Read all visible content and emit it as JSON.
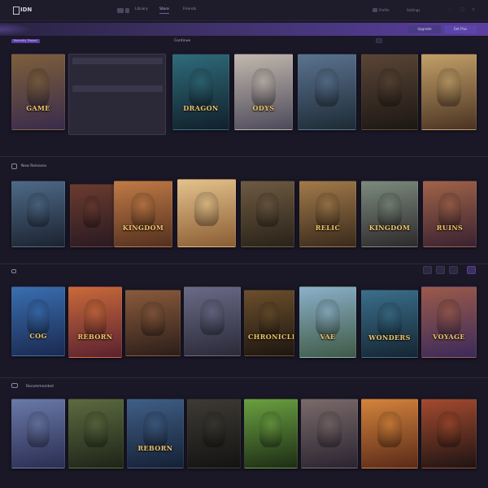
{
  "app": {
    "logo_text": "IDN"
  },
  "topbar": {
    "nav": [
      "Library",
      "Store",
      "Friends"
    ],
    "links": [
      "Profile",
      "Settings"
    ],
    "window_controls": [
      "–",
      "□",
      "×"
    ]
  },
  "banner": {
    "buttons": [
      "Upgrade",
      "Get Plus"
    ]
  },
  "sections": [
    {
      "tag": "Recently Played",
      "title": "Continue",
      "meta": ""
    },
    {
      "tag": "",
      "title": "New Releases",
      "meta": ""
    },
    {
      "tag": "",
      "title": "",
      "meta": ""
    },
    {
      "tag": "",
      "title": "Recommended",
      "meta": ""
    }
  ],
  "panel_rows": [
    "",
    "",
    "",
    "",
    "",
    "",
    ""
  ],
  "row1": [
    {
      "title": "GAME",
      "colors": [
        "#7d5f3b",
        "#3a2b4c"
      ]
    },
    {
      "title": "",
      "colors": []
    },
    {
      "title": "DRAGON",
      "colors": [
        "#2f6b7a",
        "#11202b"
      ]
    },
    {
      "title": "ODYS",
      "colors": [
        "#c2b8ad",
        "#4d4a5b"
      ]
    },
    {
      "title": "",
      "colors": [
        "#5b7390",
        "#1e2b36"
      ]
    },
    {
      "title": "",
      "colors": [
        "#5a4536",
        "#1c1713"
      ]
    },
    {
      "title": "",
      "colors": [
        "#c3a068",
        "#4a3322"
      ]
    }
  ],
  "row2": [
    {
      "title": "",
      "colors": [
        "#4e6a88",
        "#1c2330"
      ]
    },
    {
      "title": "",
      "colors": [
        "#6b3b2e",
        "#2a1a22"
      ]
    },
    {
      "title": "KINGDOM",
      "colors": [
        "#c07a46",
        "#54301f"
      ]
    },
    {
      "title": "",
      "colors": [
        "#e3c28c",
        "#8b5d33"
      ]
    },
    {
      "title": "",
      "colors": [
        "#6d5a42",
        "#2a2218"
      ]
    },
    {
      "title": "RELIC",
      "colors": [
        "#a27a4a",
        "#3a2a1c"
      ]
    },
    {
      "title": "KINGDOM",
      "colors": [
        "#7c8a7e",
        "#2d2a2c"
      ]
    },
    {
      "title": "RUINS",
      "colors": [
        "#a06348",
        "#3a2231"
      ]
    }
  ],
  "row3": [
    {
      "title": "COG",
      "colors": [
        "#3a6eb0",
        "#1a2a50"
      ]
    },
    {
      "title": "REBORN",
      "colors": [
        "#c96a3a",
        "#5b2130"
      ]
    },
    {
      "title": "",
      "colors": [
        "#8a5a3c",
        "#2c1e19"
      ]
    },
    {
      "title": "",
      "colors": [
        "#6a6a88",
        "#2a2a38"
      ]
    },
    {
      "title": "CHRONICLE",
      "colors": [
        "#6b4e2c",
        "#1d1610"
      ]
    },
    {
      "title": "VAE",
      "colors": [
        "#8bb0c9",
        "#3f5a45"
      ]
    },
    {
      "title": "WONDERS",
      "colors": [
        "#3a6f8a",
        "#152533"
      ]
    },
    {
      "title": "VOYAGE",
      "colors": [
        "#9b5a4a",
        "#3b2a5a"
      ]
    }
  ],
  "row4": [
    {
      "title": "",
      "colors": [
        "#6a79a8",
        "#2a2e52"
      ]
    },
    {
      "title": "",
      "colors": [
        "#5b6b40",
        "#1f2418"
      ]
    },
    {
      "title": "REBORN",
      "colors": [
        "#3f5f86",
        "#152035"
      ]
    },
    {
      "title": "",
      "colors": [
        "#3d3a35",
        "#141312"
      ]
    },
    {
      "title": "",
      "colors": [
        "#6aa040",
        "#1d2d16"
      ]
    },
    {
      "title": "",
      "colors": [
        "#7a6a6a",
        "#2a2430"
      ]
    },
    {
      "title": "",
      "colors": [
        "#d4833c",
        "#5a2a18"
      ]
    },
    {
      "title": "",
      "colors": [
        "#a44a2e",
        "#1e1414"
      ]
    }
  ],
  "captions": {
    "r1": [
      "",
      "",
      "",
      "",
      "",
      "",
      ""
    ],
    "r2": [
      "",
      "",
      "",
      "",
      "",
      "",
      "",
      ""
    ],
    "r3": [
      "",
      "",
      "",
      "",
      "",
      "",
      "",
      ""
    ],
    "r4": [
      "",
      "",
      "",
      "",
      "",
      "",
      "",
      ""
    ]
  }
}
